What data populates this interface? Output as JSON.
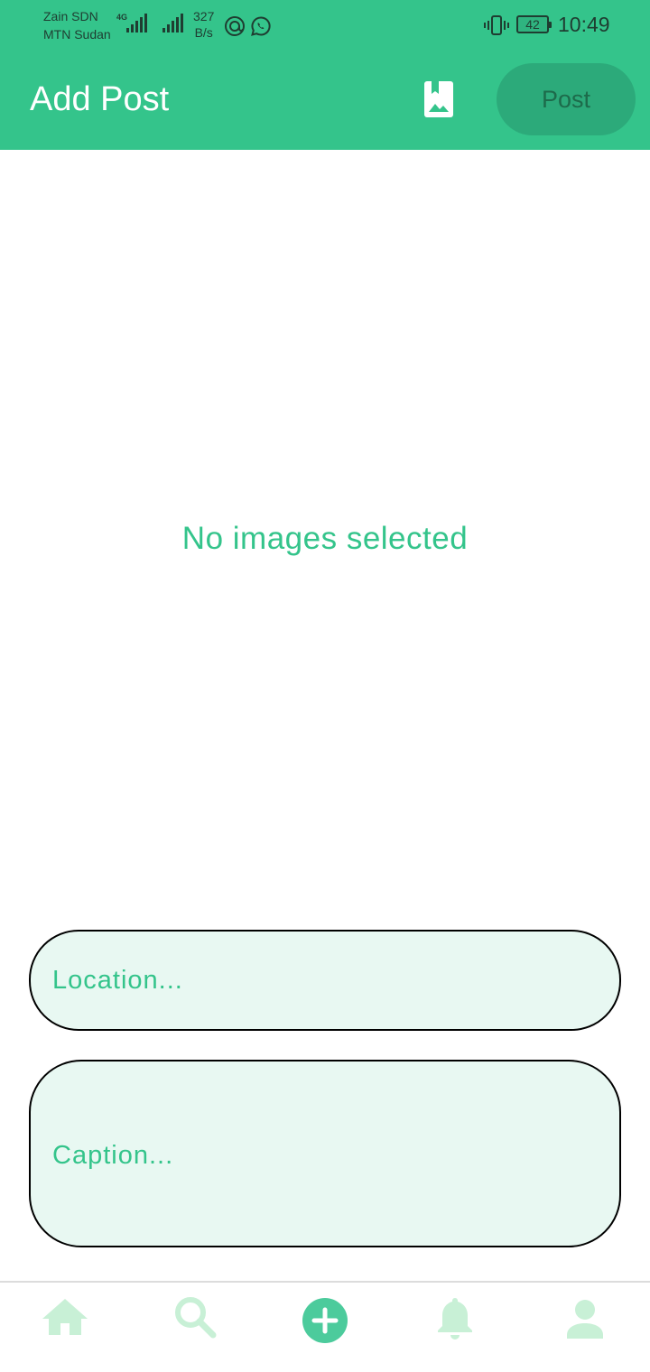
{
  "status_bar": {
    "carrier_1": "Zain SDN",
    "carrier_2": "MTN Sudan",
    "network_type": "4G",
    "speed_value": "327",
    "speed_unit": "B/s",
    "battery_level": "42",
    "time": "10:49"
  },
  "app_bar": {
    "title": "Add Post",
    "gallery_icon": "photo-album-icon",
    "post_label": "Post"
  },
  "main": {
    "empty_message": "No images selected",
    "location_placeholder": "Location...",
    "caption_placeholder": "Caption..."
  },
  "bottom_nav": {
    "items": [
      {
        "icon": "home-icon"
      },
      {
        "icon": "search-icon"
      },
      {
        "icon": "add-circle-icon"
      },
      {
        "icon": "bell-icon"
      },
      {
        "icon": "person-icon"
      }
    ]
  },
  "colors": {
    "primary": "#34c48b",
    "post_button_bg": "#2caa7a",
    "field_bg": "#e8f8f2",
    "nav_inactive": "#c8f0d6",
    "nav_active": "#4ccb9c"
  }
}
